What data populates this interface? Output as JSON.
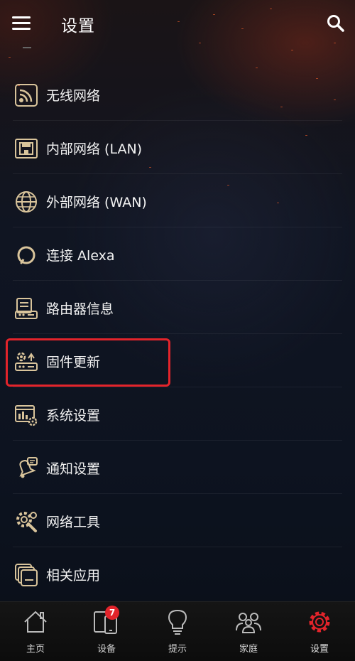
{
  "header": {
    "title": "设置"
  },
  "menu": {
    "items": [
      {
        "label": "无线网络",
        "icon": "wifi-icon"
      },
      {
        "label": "内部网络 (LAN)",
        "icon": "lan-port-icon"
      },
      {
        "label": "外部网络 (WAN)",
        "icon": "globe-icon"
      },
      {
        "label": "连接 Alexa",
        "icon": "alexa-icon"
      },
      {
        "label": "路由器信息",
        "icon": "router-info-icon"
      },
      {
        "label": "固件更新",
        "icon": "firmware-update-icon",
        "highlighted": true
      },
      {
        "label": "系统设置",
        "icon": "system-settings-icon"
      },
      {
        "label": "通知设置",
        "icon": "notification-icon"
      },
      {
        "label": "网络工具",
        "icon": "network-tools-icon"
      },
      {
        "label": "相关应用",
        "icon": "related-apps-icon"
      }
    ]
  },
  "bottom_nav": {
    "items": [
      {
        "label": "主页",
        "icon": "home-icon"
      },
      {
        "label": "设备",
        "icon": "devices-icon",
        "badge": "7"
      },
      {
        "label": "提示",
        "icon": "lightbulb-icon"
      },
      {
        "label": "家庭",
        "icon": "family-icon"
      },
      {
        "label": "设置",
        "icon": "gear-icon",
        "active": true
      }
    ]
  },
  "colors": {
    "accent": "#e3242b",
    "icon_gold": "#d9c49b",
    "highlight_border": "#e3242b",
    "badge": "#e3242b"
  }
}
